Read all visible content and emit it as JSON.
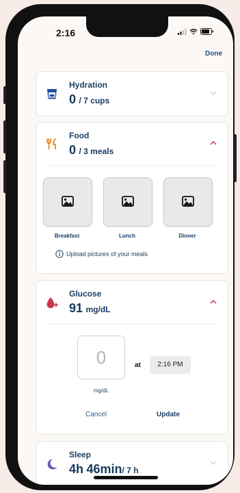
{
  "status": {
    "time": "2:16"
  },
  "header": {
    "done_label": "Done"
  },
  "hydration": {
    "title": "Hydration",
    "value": "0",
    "unit": "/ 7 cups"
  },
  "food": {
    "title": "Food",
    "value": "0",
    "unit": "/ 3 meals",
    "meals": [
      {
        "label": "Breakfast"
      },
      {
        "label": "Lunch"
      },
      {
        "label": "Dinner"
      }
    ],
    "upload_hint": "Upload pictures of your meals"
  },
  "glucose": {
    "title": "Glucose",
    "value": "91",
    "unit": "mg/dL",
    "input_value": "0",
    "input_unit": "mg/dL",
    "at_label": "at",
    "time": "2:16 PM",
    "cancel_label": "Cancel",
    "update_label": "Update"
  },
  "sleep": {
    "title": "Sleep",
    "hours": "4",
    "hours_unit": "h",
    "minutes": "46",
    "minutes_unit": "min",
    "goal": "/ 7 h"
  },
  "colors": {
    "hydration_icon": "#1f4f9a",
    "food_icon": "#e08a1e",
    "glucose_icon": "#c9384a",
    "sleep_icon": "#6b55b0",
    "accent_text": "#1b3f63",
    "chevron_open": "#c9384a"
  }
}
